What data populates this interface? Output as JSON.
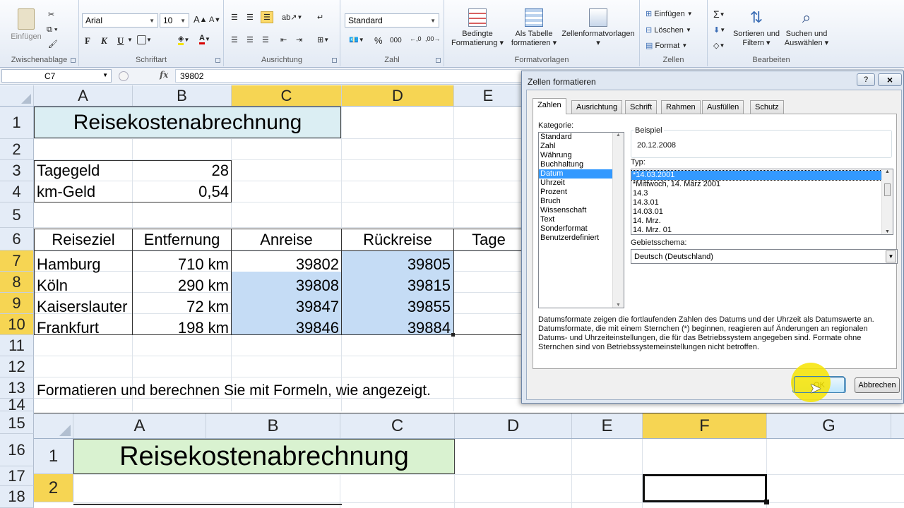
{
  "ribbon": {
    "clipboard": {
      "paste": "Einfügen",
      "group": "Zwischenablage"
    },
    "font": {
      "name": "Arial",
      "size": "10",
      "bold": "F",
      "italic": "K",
      "underline": "U",
      "group": "Schriftart"
    },
    "alignment": {
      "group": "Ausrichtung"
    },
    "number": {
      "format": "Standard",
      "percent": "%",
      "thousands": "000",
      "group": "Zahl"
    },
    "styles": {
      "conditional": "Bedingte Formatierung",
      "as_table": "Als Tabelle formatieren",
      "cell_styles": "Zellenformatvorlagen",
      "group": "Formatvorlagen"
    },
    "cells": {
      "insert": "Einfügen",
      "delete": "Löschen",
      "format": "Format",
      "group": "Zellen"
    },
    "editing": {
      "sum": "Σ",
      "sort": "Sortieren und Filtern",
      "find": "Suchen und Auswählen",
      "group": "Bearbeiten"
    }
  },
  "formula_bar": {
    "name_box": "C7",
    "fx": "fx",
    "value": "39802"
  },
  "sheet1": {
    "columns": [
      "A",
      "B",
      "C",
      "D",
      "E"
    ],
    "rows": [
      "1",
      "2",
      "3",
      "4",
      "5",
      "6",
      "7",
      "8",
      "9",
      "10",
      "11",
      "12",
      "13",
      "14"
    ],
    "title": "Reisekostenabrechnung",
    "tagegeld_label": "Tagegeld",
    "tagegeld_value": "28",
    "kmgeld_label": "km-Geld",
    "kmgeld_value": "0,54",
    "headers": [
      "Reiseziel",
      "Entfernung",
      "Anreise",
      "Rückreise",
      "Tage"
    ],
    "data": [
      {
        "ziel": "Hamburg",
        "entf": "710 km",
        "an": "39802",
        "rueck": "39805"
      },
      {
        "ziel": "Köln",
        "entf": "290 km",
        "an": "39808",
        "rueck": "39815"
      },
      {
        "ziel": "Kaiserslauter",
        "entf": "72 km",
        "an": "39847",
        "rueck": "39855"
      },
      {
        "ziel": "Frankfurt",
        "entf": "198 km",
        "an": "39846",
        "rueck": "39884"
      }
    ],
    "instruction": "Formatieren und berechnen Sie mit Formeln, wie angezeigt."
  },
  "sheet2": {
    "columns": [
      "A",
      "B",
      "C",
      "D",
      "E",
      "F",
      "G"
    ],
    "rows": [
      "15",
      "16",
      "17",
      "18"
    ],
    "inner_rows": [
      "1",
      "2"
    ],
    "title": "Reisekostenabrechnung"
  },
  "dialog": {
    "title": "Zellen formatieren",
    "help": "?",
    "close": "×",
    "tabs": [
      "Zahlen",
      "Ausrichtung",
      "Schrift",
      "Rahmen",
      "Ausfüllen",
      "Schutz"
    ],
    "category_label": "Kategorie:",
    "categories": [
      "Standard",
      "Zahl",
      "Währung",
      "Buchhaltung",
      "Datum",
      "Uhrzeit",
      "Prozent",
      "Bruch",
      "Wissenschaft",
      "Text",
      "Sonderformat",
      "Benutzerdefiniert"
    ],
    "selected_category": "Datum",
    "sample_label": "Beispiel",
    "sample_value": "20.12.2008",
    "type_label": "Typ:",
    "types": [
      "*14.03.2001",
      "*Mittwoch, 14. März 2001",
      "14.3",
      "14.3.01",
      "14.03.01",
      "14. Mrz.",
      "14. Mrz. 01"
    ],
    "locale_label": "Gebietsschema:",
    "locale_value": "Deutsch (Deutschland)",
    "description": "Datumsformate zeigen die fortlaufenden Zahlen des Datums und der Uhrzeit als Datumswerte an. Datumsformate, die mit einem Sternchen (*) beginnen, reagieren auf Änderungen an regionalen Datums- und Uhrzeiteinstellungen, die für das Betriebssystem angegeben sind. Formate ohne Sternchen sind von Betriebssystemeinstellungen nicht betroffen.",
    "ok": "OK",
    "cancel": "Abbrechen"
  },
  "colors": {
    "selection": "#c5dcf5",
    "title_fill_1": "#dbeef3",
    "title_fill_2": "#d9f2d0",
    "highlight": "#f7e400",
    "active_header": "#f6d553"
  }
}
